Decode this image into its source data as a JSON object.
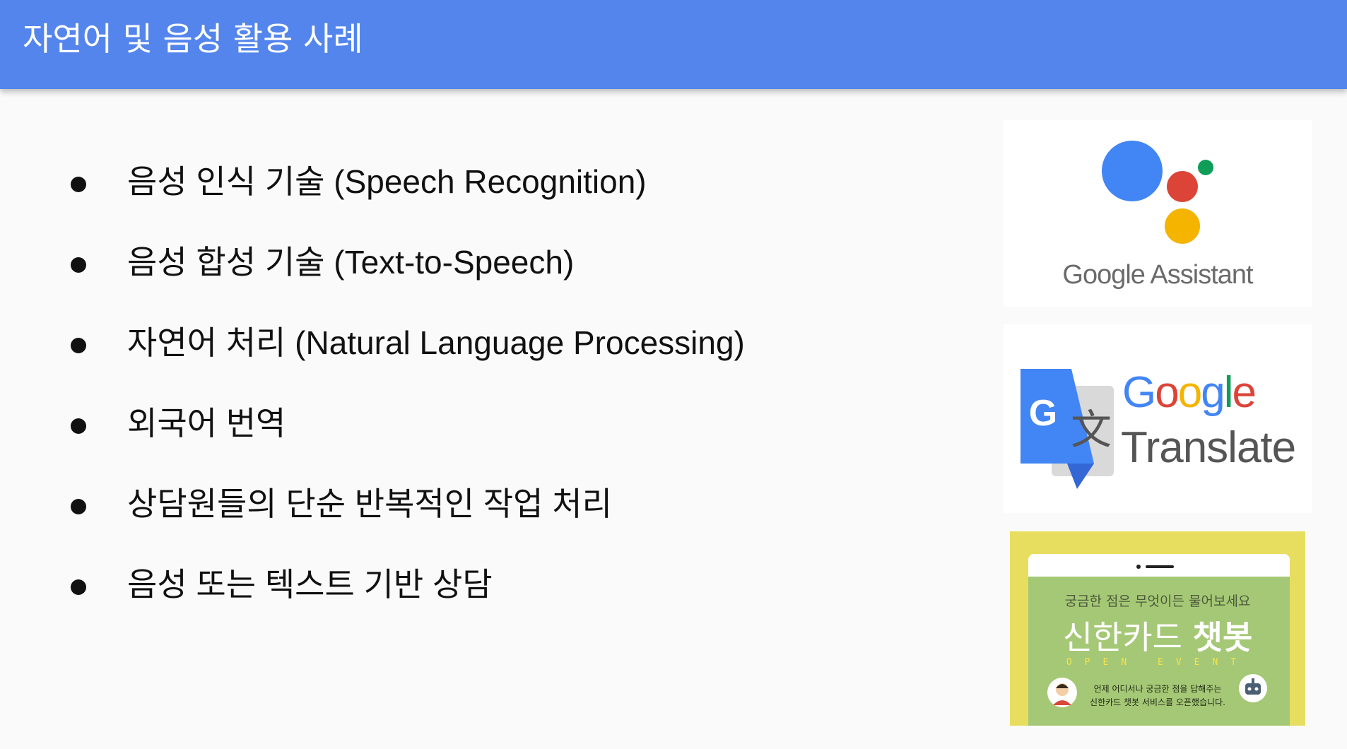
{
  "slide": {
    "title": "자연어 및 음성 활용 사례",
    "bullets": [
      "음성 인식 기술 (Speech Recognition)",
      "음성 합성 기술 (Text-to-Speech)",
      "자연어 처리 (Natural Language Processing)",
      "외국어 번역",
      "상담원들의 단순 반복적인 작업 처리",
      "음성 또는 텍스트 기반 상담"
    ]
  },
  "images": {
    "google_assistant": {
      "label": "Google Assistant",
      "colors": {
        "blue": "#4285f4",
        "red": "#db4437",
        "yellow": "#f4b400",
        "green": "#0f9d58"
      }
    },
    "google_translate": {
      "word1": "Google",
      "word2": "Translate",
      "icon_letter": "G",
      "icon_glyph": "文"
    },
    "shinhan_chatbot": {
      "subtitle": "궁금한 점은 무엇이든 물어보세요",
      "title_light": "신한카드 ",
      "title_bold": "챗봇",
      "event": "OPEN EVENT",
      "desc_line1": "언제 어디서나 궁금한 점을 답해주는",
      "desc_line2": "신한카드 챗봇 서비스를 오픈했습니다."
    }
  },
  "colors": {
    "header": "#5385ec",
    "background": "#fafafa",
    "text": "#111111"
  }
}
